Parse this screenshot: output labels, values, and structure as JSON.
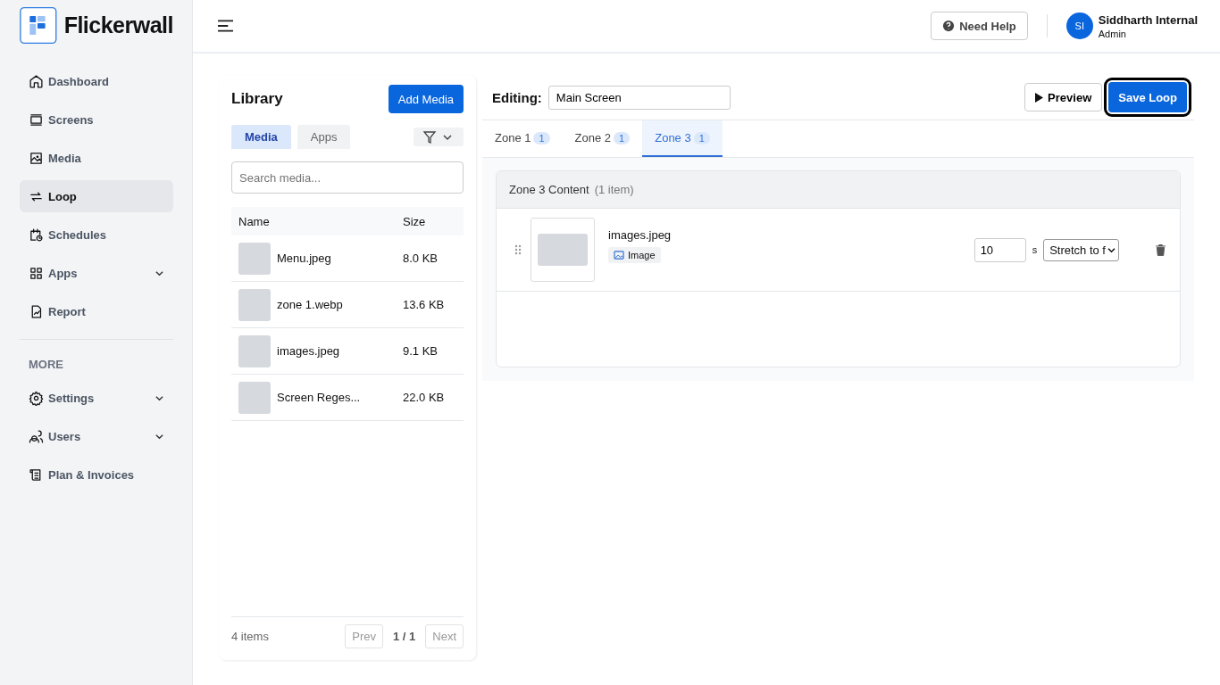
{
  "brand": {
    "name": "Flickerwall"
  },
  "nav": [
    {
      "label": "Dashboard",
      "selected": false,
      "submenu": false
    },
    {
      "label": "Screens",
      "selected": false,
      "submenu": false
    },
    {
      "label": "Media",
      "selected": false,
      "submenu": false
    },
    {
      "label": "Loop",
      "selected": true,
      "submenu": false
    },
    {
      "label": "Schedules",
      "selected": false,
      "submenu": false
    },
    {
      "label": "Apps",
      "selected": false,
      "submenu": true
    },
    {
      "label": "Report",
      "selected": false,
      "submenu": false
    }
  ],
  "more_heading": "MORE",
  "more_nav": [
    {
      "label": "Settings",
      "selected": false,
      "submenu": true
    },
    {
      "label": "Users",
      "selected": false,
      "submenu": true
    },
    {
      "label": "Plan & Invoices",
      "selected": false,
      "submenu": false
    }
  ],
  "header": {
    "help": "Need Help",
    "user": {
      "initials": "SI",
      "name": "Siddharth Internal",
      "role": "Admin"
    }
  },
  "library": {
    "title": "Library",
    "add_button": "Add Media",
    "tabs": [
      {
        "label": "Media",
        "selected": true
      },
      {
        "label": "Apps",
        "selected": false
      }
    ],
    "search": {
      "placeholder": "Search media..."
    },
    "columns": [
      "Name",
      "Size"
    ],
    "rows": [
      {
        "name": "Menu.jpeg",
        "size": "8.0 KB"
      },
      {
        "name": "zone 1.webp",
        "size": "13.6 KB"
      },
      {
        "name": "images.jpeg",
        "size": "9.1 KB"
      },
      {
        "name": "Screen Reges...",
        "size": "22.0 KB"
      }
    ],
    "count": "4 items",
    "pager": {
      "prev": {
        "label": "Prev",
        "disabled": true
      },
      "page": "1 / 1",
      "next": {
        "label": "Next",
        "disabled": true
      }
    }
  },
  "editor": {
    "label": "Editing:",
    "name_value": "Main Screen",
    "preview": "Preview",
    "save": {
      "label": "Save Loop",
      "focused": true
    },
    "zones": [
      {
        "label": "Zone 1",
        "count": "1",
        "selected": false
      },
      {
        "label": "Zone 2",
        "count": "1",
        "selected": false
      },
      {
        "label": "Zone 3",
        "count": "1",
        "selected": true
      }
    ],
    "content": {
      "title": "Zone 3 Content",
      "count": "(1 item)",
      "items": [
        {
          "name": "images.jpeg",
          "type": "Image",
          "duration": "10",
          "unit": "s",
          "fit": "Stretch to f"
        }
      ]
    }
  }
}
